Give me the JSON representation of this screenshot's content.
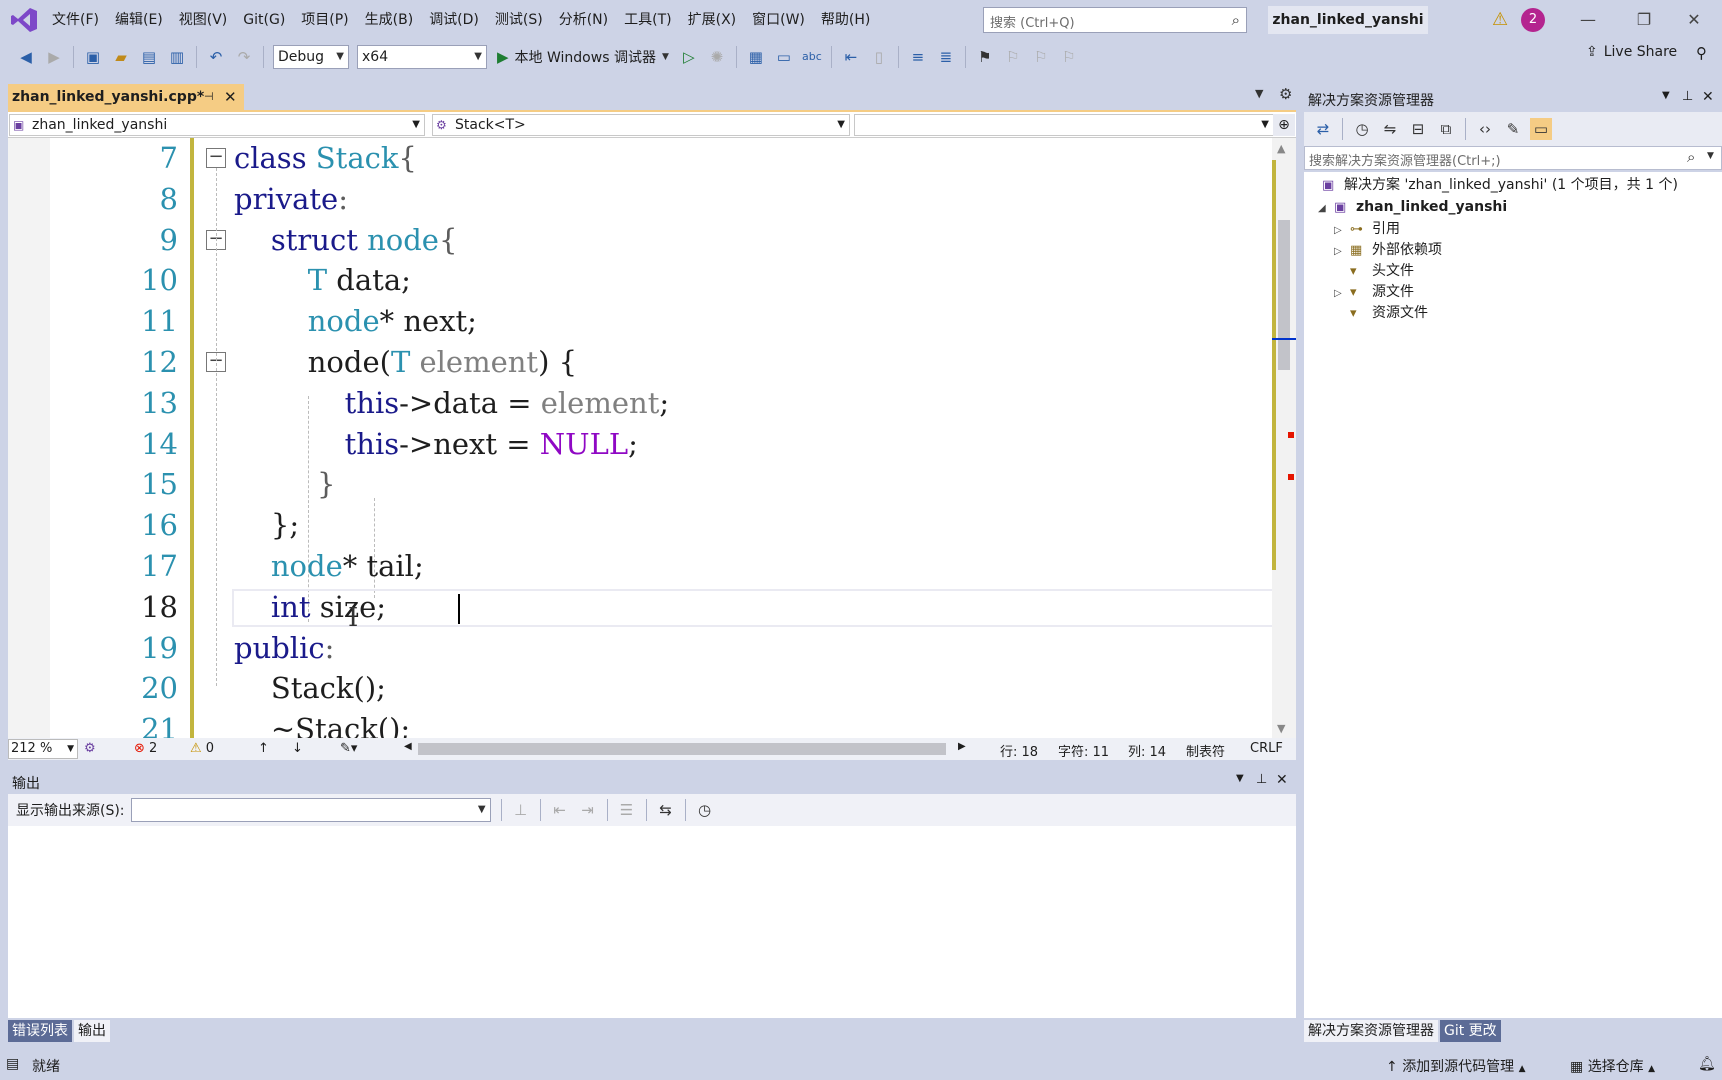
{
  "menu": [
    "文件(F)",
    "编辑(E)",
    "视图(V)",
    "Git(G)",
    "项目(P)",
    "生成(B)",
    "调试(D)",
    "测试(S)",
    "分析(N)",
    "工具(T)",
    "扩展(X)",
    "窗口(W)",
    "帮助(H)"
  ],
  "search": {
    "placeholder": "搜索 (Ctrl+Q)"
  },
  "solution_title": "zhan_linked_yanshi",
  "notification_count": "2",
  "toolbar": {
    "config": "Debug",
    "platform": "x64",
    "run_label": "本地 Windows 调试器",
    "live_share": "Live Share"
  },
  "editor": {
    "tab_label": "zhan_linked_yanshi.cpp*",
    "nav_project": "zhan_linked_yanshi",
    "nav_scope": "Stack<T>",
    "nav_member": "",
    "lines": [
      {
        "num": "7",
        "tokens": [
          {
            "t": "class ",
            "c": "kw2"
          },
          {
            "t": "Stack",
            "c": "ty"
          },
          {
            "t": "{",
            "c": "pu"
          }
        ]
      },
      {
        "num": "8",
        "tokens": [
          {
            "t": "private",
            "c": "kw2"
          },
          {
            "t": ":",
            "c": "pu"
          }
        ]
      },
      {
        "num": "9",
        "tokens": [
          {
            "t": "    struct ",
            "c": "kw2"
          },
          {
            "t": "node",
            "c": "ty"
          },
          {
            "t": "{",
            "c": "pu"
          }
        ]
      },
      {
        "num": "10",
        "tokens": [
          {
            "t": "        T",
            "c": "ty"
          },
          {
            "t": " data;",
            "c": ""
          }
        ]
      },
      {
        "num": "11",
        "tokens": [
          {
            "t": "        node",
            "c": "ty"
          },
          {
            "t": "* next;",
            "c": ""
          }
        ]
      },
      {
        "num": "12",
        "tokens": [
          {
            "t": "        node",
            "c": ""
          },
          {
            "t": "(",
            "c": ""
          },
          {
            "t": "T",
            "c": "ty"
          },
          {
            "t": " element",
            "c": "prm"
          },
          {
            "t": ") {",
            "c": ""
          }
        ]
      },
      {
        "num": "13",
        "tokens": [
          {
            "t": "            this",
            "c": "kw2"
          },
          {
            "t": "->data = ",
            "c": ""
          },
          {
            "t": "element",
            "c": "prm"
          },
          {
            "t": ";",
            "c": ""
          }
        ]
      },
      {
        "num": "14",
        "tokens": [
          {
            "t": "            this",
            "c": "kw2"
          },
          {
            "t": "->next = ",
            "c": ""
          },
          {
            "t": "NULL",
            "c": "mac"
          },
          {
            "t": ";",
            "c": ""
          }
        ]
      },
      {
        "num": "15",
        "tokens": [
          {
            "t": "         }",
            "c": "pu"
          }
        ]
      },
      {
        "num": "16",
        "tokens": [
          {
            "t": "    };",
            "c": ""
          }
        ]
      },
      {
        "num": "17",
        "tokens": [
          {
            "t": "    node",
            "c": "ty"
          },
          {
            "t": "* tail;",
            "c": ""
          }
        ]
      },
      {
        "num": "18",
        "tokens": [
          {
            "t": "    int",
            "c": "kw2"
          },
          {
            "t": " size;",
            "c": ""
          }
        ]
      },
      {
        "num": "19",
        "tokens": [
          {
            "t": "public",
            "c": "kw2"
          },
          {
            "t": ":",
            "c": "pu"
          }
        ]
      },
      {
        "num": "20",
        "tokens": [
          {
            "t": "    Stack",
            "c": ""
          },
          {
            "t": "();",
            "c": ""
          }
        ]
      },
      {
        "num": "21",
        "tokens": [
          {
            "t": "    ~Stack",
            "c": ""
          },
          {
            "t": "();",
            "c": ""
          }
        ]
      }
    ],
    "current_line_index": 11
  },
  "editor_status": {
    "zoom": "212 %",
    "errors": "2",
    "warnings": "0",
    "line": "行: 18",
    "char": "字符: 11",
    "col": "列: 14",
    "indent": "制表符",
    "eol": "CRLF"
  },
  "output": {
    "title": "输出",
    "source_label": "显示输出来源(S):",
    "source_value": ""
  },
  "bottom_tabs": [
    "错误列表",
    "输出"
  ],
  "solution_explorer": {
    "title": "解决方案资源管理器",
    "search_placeholder": "搜索解决方案资源管理器(Ctrl+;)",
    "solution_row": "解决方案 'zhan_linked_yanshi' (1 个项目，共 1 个)",
    "project": "zhan_linked_yanshi",
    "items": [
      {
        "label": "引用",
        "expandable": true,
        "icon": "references-icon"
      },
      {
        "label": "外部依赖项",
        "expandable": true,
        "icon": "external-deps-icon"
      },
      {
        "label": "头文件",
        "expandable": false,
        "icon": "folder-filter-icon"
      },
      {
        "label": "源文件",
        "expandable": true,
        "icon": "folder-filter-icon"
      },
      {
        "label": "资源文件",
        "expandable": false,
        "icon": "folder-filter-icon"
      }
    ],
    "tabs": [
      "解决方案资源管理器",
      "Git 更改"
    ]
  },
  "statusbar": {
    "ready": "就绪",
    "add_source_control": "添加到源代码管理",
    "select_repo": "选择仓库"
  }
}
